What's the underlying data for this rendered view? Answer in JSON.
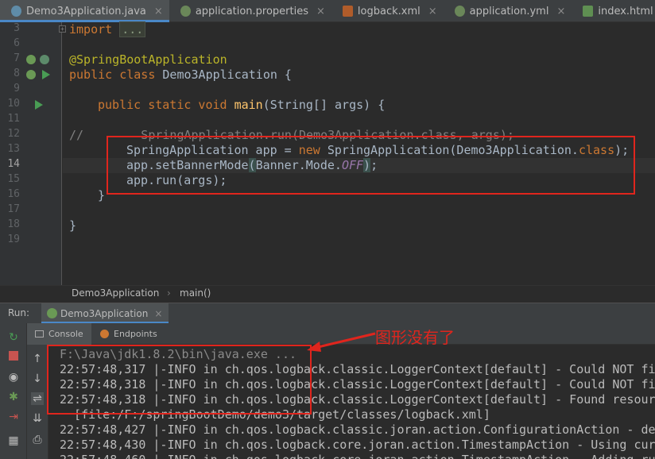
{
  "tabs": [
    {
      "label": "Demo3Application.java",
      "icon": "java-class-icon",
      "active": true
    },
    {
      "label": "application.properties",
      "icon": "properties-file-icon",
      "active": false
    },
    {
      "label": "logback.xml",
      "icon": "xml-file-icon",
      "active": false
    },
    {
      "label": "application.yml",
      "icon": "yml-file-icon",
      "active": false
    },
    {
      "label": "index.html",
      "icon": "html-file-icon",
      "active": false
    }
  ],
  "tab_close_glyph": "×",
  "editor": {
    "line_numbers": [
      "3",
      "6",
      "7",
      "8",
      "9",
      "10",
      "11",
      "12",
      "13",
      "14",
      "15",
      "16",
      "17",
      "18",
      "19"
    ],
    "lines": {
      "l3_kw": "import",
      "l3_fold": "...",
      "l7": "@SpringBootApplication",
      "l8_kw": "public class ",
      "l8_rest": "Demo3Application {",
      "l10_kw": "public static void ",
      "l10_fn": "main",
      "l10_rest": "(String[] args) {",
      "l12": "//        SpringApplication.run(Demo3Application.class, args);",
      "l13_a": "SpringApplication app = ",
      "l13_kw": "new ",
      "l13_b": "SpringApplication(Demo3Application.",
      "l13_kw2": "class",
      "l13_c": ");",
      "l14_a": "app.setBannerMode",
      "l14_paren": "(",
      "l14_b": "Banner",
      "l14_c": ".Mode.",
      "l14_it": "OFF",
      "l14_paren2": ")",
      "l14_d": ";",
      "l15": "app.run(args);",
      "l16": "}",
      "l18": "}"
    }
  },
  "breadcrumb": {
    "class": "Demo3Application",
    "sep": "›",
    "method": "main()"
  },
  "run": {
    "label": "Run:",
    "tab": "Demo3Application",
    "close": "×"
  },
  "subtabs": {
    "console": "Console",
    "endpoints": "Endpoints"
  },
  "console": [
    "F:\\Java\\jdk1.8.2\\bin\\java.exe ...",
    "22:57:48,317 |-INFO in ch.qos.logback.classic.LoggerContext[default] - Could NOT fir",
    "22:57:48,318 |-INFO in ch.qos.logback.classic.LoggerContext[default] - Could NOT fir",
    "22:57:48,318 |-INFO in ch.qos.logback.classic.LoggerContext[default] - Found resour",
    "  [file:/F:/springBootDemo/demo3/target/classes/logback.xml]",
    "22:57:48,427 |-INFO in ch.qos.logback.classic.joran.action.ConfigurationAction - de",
    "22:57:48,430 |-INFO in ch.qos.logback.core.joran.action.TimestampAction - Using cur",
    "22:57:48,460 |-INFO in ch.qos.logback.core.joran.action.TimestampAction - Adding ru"
  ],
  "annotation": "图形没有了",
  "colors": {
    "highlight_box": "#e0251d",
    "keyword": "#cc7832",
    "annotation": "#bbb529",
    "run_green": "#499c54",
    "accent": "#4a88c7"
  }
}
